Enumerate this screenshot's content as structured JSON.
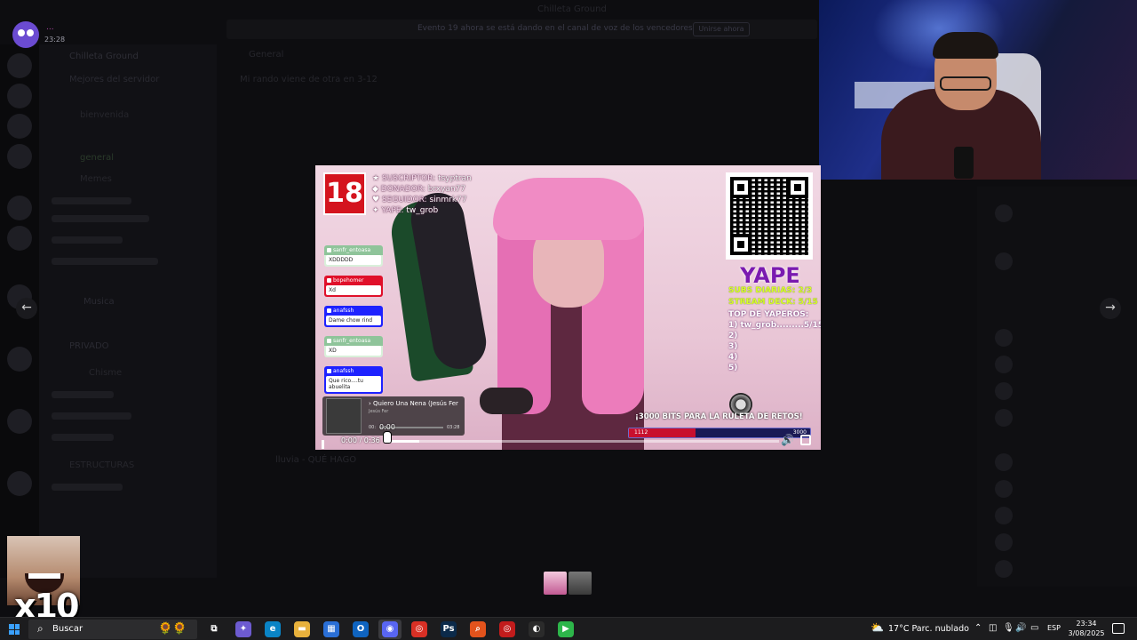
{
  "viewer": {
    "user_name": "...",
    "user_time": "23:28",
    "prev_label": "←",
    "next_label": "→"
  },
  "background": {
    "window_title": "Chilleta Ground",
    "banner_text": "Evento 19 ahora se está dando en el canal de voz de los vencedores",
    "banner_button": "Unirse ahora",
    "server_name": "Chilleta Ground",
    "channels": [
      "Mejores del servidor",
      "bienvenida",
      "general",
      "Memes",
      "Musica",
      "PRIVADO",
      "Chisme",
      "ESTRUCTURAS"
    ],
    "chat_header": "General",
    "chat_hint": "Mi rando viene de otra en 3-12",
    "message_text": "lluvia - QUÉ HAGO"
  },
  "stream": {
    "badge": "18",
    "info": [
      {
        "icon": "★",
        "label": "SUSCRIPTOR:",
        "value": "tsyptran"
      },
      {
        "icon": "◆",
        "label": "DONADOR:",
        "value": "brxyan77"
      },
      {
        "icon": "♥",
        "label": "SEGUIDOR:",
        "value": "sinmrk77"
      },
      {
        "icon": "✦",
        "label": "YAPE:",
        "value": "tw_grob"
      }
    ],
    "chat": [
      {
        "user": "sanfr_entoasa",
        "msg": "XDDDDD",
        "color": "#d9f0da"
      },
      {
        "user": "bopehomer",
        "msg": "Xd",
        "color": "#e0102a"
      },
      {
        "user": "anafssh",
        "msg": "Dame chow rind",
        "color": "#1e22ff"
      },
      {
        "user": "sanfr_entoasa",
        "msg": "XD",
        "color": "#d9f0da"
      },
      {
        "user": "anafssh",
        "msg": "Que rico....tu abuelita",
        "color": "#1e22ff"
      }
    ],
    "yape_title": "YAPE",
    "subs": "SUBS DIARIAS: 2/3",
    "stream_deck": "STREAM DECK: 5/15",
    "top_title": "TOP DE YAPEROS:",
    "top_list": [
      "1) tw_grob.........5/15",
      "2)",
      "3)",
      "4)",
      "5)"
    ],
    "bits_text": "¡3000 BITS PARA LA RULETA DE RETOS!",
    "bits_current": "1112",
    "bits_max": "3000",
    "bits_progress": 0.37,
    "song_title": "› Quiero Una Nena (Jesús Fer",
    "song_artist": "Jesús Fer",
    "song_elapsed": "0:00",
    "song_current": "00:",
    "song_total": "03:28"
  },
  "player": {
    "time_display": "0:00 / 0:36",
    "hover_time": "0:00",
    "progress": 0.08,
    "volume_icon": "🔊"
  },
  "meme": {
    "caption": "x10"
  },
  "taskbar": {
    "search_label": "Buscar",
    "weather": "17°C  Parc. nublado",
    "language": "ESP",
    "time": "23:34",
    "date": "3/08/2025",
    "apps": [
      {
        "name": "task-view-icon",
        "glyph": "⧉",
        "bg": "#1c1c1e"
      },
      {
        "name": "copilot-icon",
        "glyph": "✦",
        "bg": "#6d5bd0"
      },
      {
        "name": "edge-icon",
        "glyph": "e",
        "bg": "#0a84c6"
      },
      {
        "name": "file-explorer-icon",
        "glyph": "▬",
        "bg": "#e8b13c"
      },
      {
        "name": "store-icon",
        "glyph": "▦",
        "bg": "#2a6fd6"
      },
      {
        "name": "outlook-icon",
        "glyph": "O",
        "bg": "#0f64c0"
      },
      {
        "name": "discord-icon",
        "glyph": "◉",
        "bg": "#5865f2"
      },
      {
        "name": "chrome-icon",
        "glyph": "◎",
        "bg": "#d93025"
      },
      {
        "name": "photoshop-icon",
        "glyph": "Ps",
        "bg": "#0b2a4a"
      },
      {
        "name": "search-app-icon",
        "glyph": "⌕",
        "bg": "#e3531c"
      },
      {
        "name": "chrome-alt-icon",
        "glyph": "◎",
        "bg": "#c21c1c"
      },
      {
        "name": "obs-icon",
        "glyph": "◐",
        "bg": "#2b2b2b"
      },
      {
        "name": "media-player-icon",
        "glyph": "▶",
        "bg": "#2db54a"
      }
    ]
  }
}
